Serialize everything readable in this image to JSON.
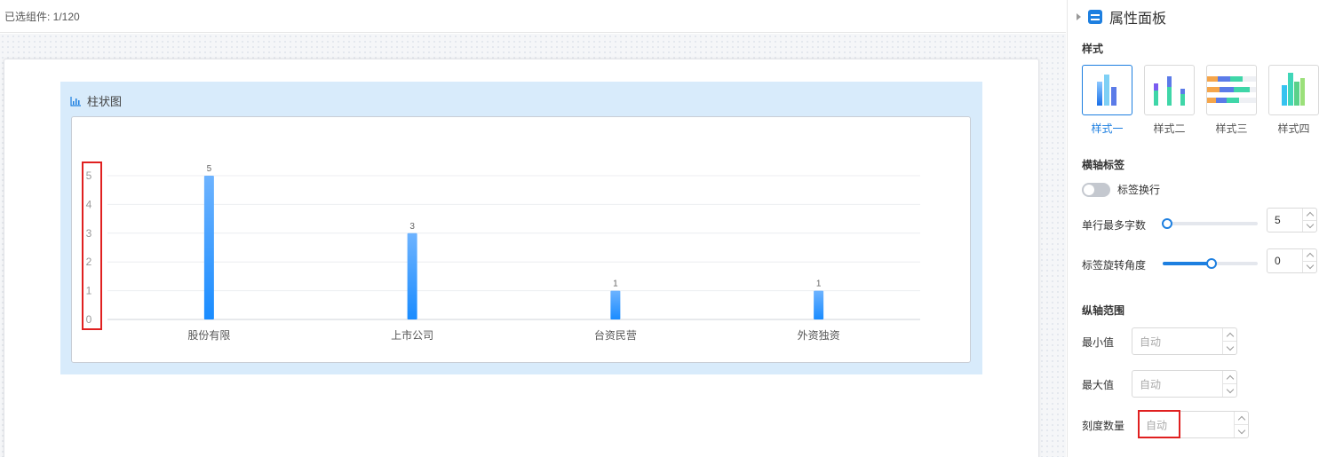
{
  "topbar": {
    "selected_text": "已选组件:  1/120"
  },
  "widget": {
    "title": "柱状图"
  },
  "chart_data": {
    "type": "bar",
    "categories": [
      "股份有限",
      "上市公司",
      "台资民营",
      "外资独资"
    ],
    "values": [
      5,
      3,
      1,
      1
    ],
    "ylim": [
      0,
      5
    ],
    "yticks": [
      "0",
      "1",
      "2",
      "3",
      "4",
      "5"
    ],
    "grid": true,
    "bar_color": "#1a8cff"
  },
  "panel": {
    "title": "属性面板",
    "style_section": "样式",
    "styles": [
      {
        "label": "样式一",
        "active": true
      },
      {
        "label": "样式二",
        "active": false
      },
      {
        "label": "样式三",
        "active": false
      },
      {
        "label": "样式四",
        "active": false
      }
    ],
    "x_axis_section": "横轴标签",
    "wrap_label": "标签换行",
    "wrap_on": false,
    "max_chars_label": "单行最多字数",
    "max_chars_value": "5",
    "rotate_label": "标签旋转角度",
    "rotate_value": "0",
    "y_axis_section": "纵轴范围",
    "min_label": "最小值",
    "min_placeholder": "自动",
    "max_label": "最大值",
    "max_placeholder": "自动",
    "ticks_label": "刻度数量",
    "ticks_placeholder": "自动"
  },
  "colors": {
    "accent": "#1d7fe0",
    "highlight": "#e02020"
  }
}
